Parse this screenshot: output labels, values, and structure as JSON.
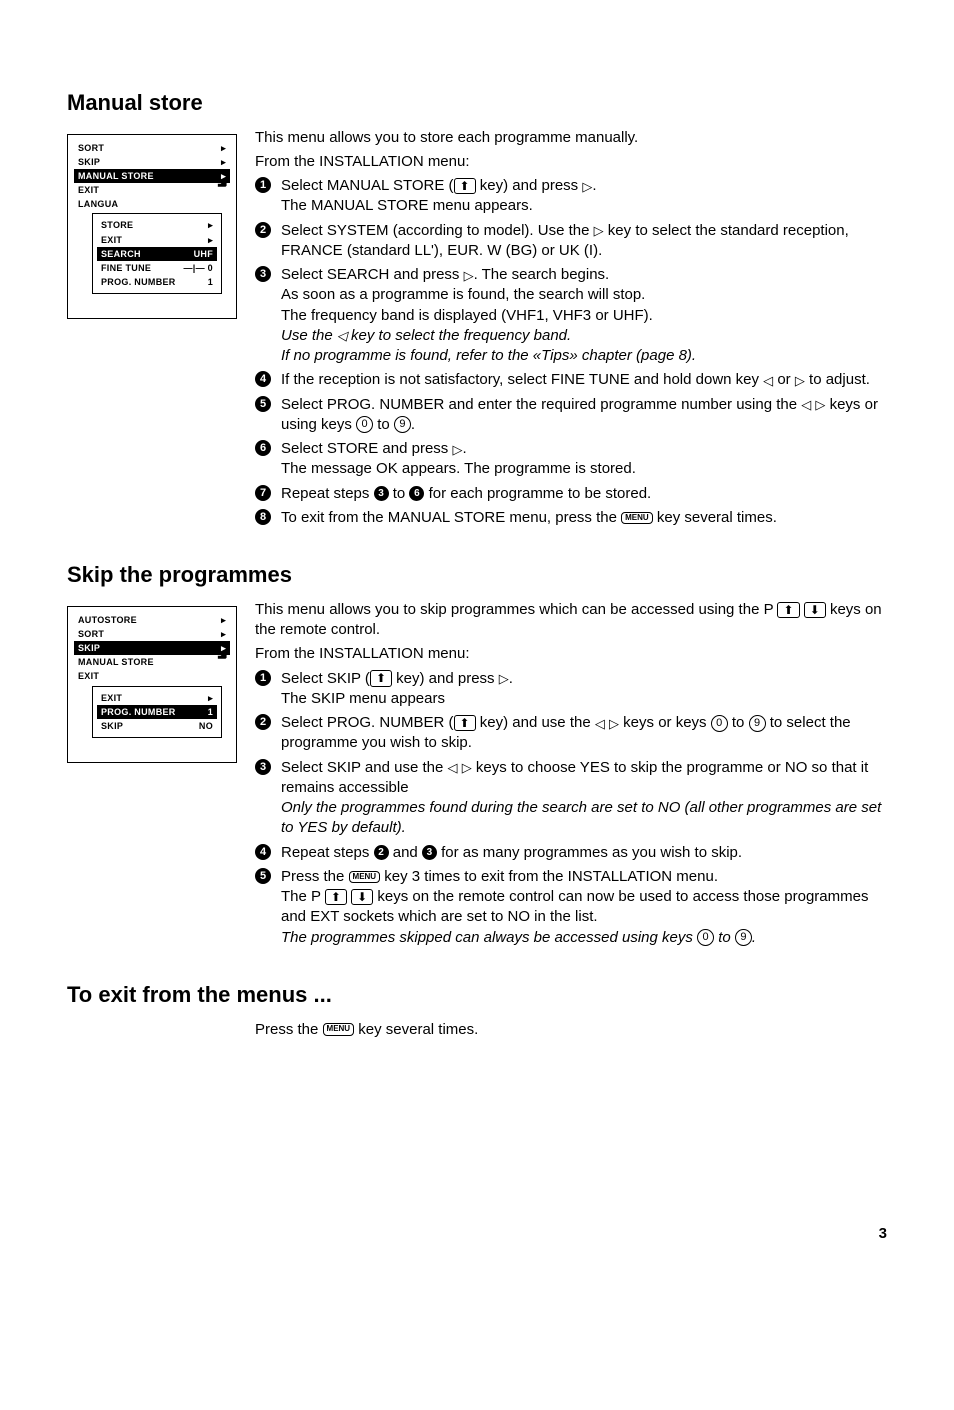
{
  "page_number": "3",
  "sections": {
    "manual_store": {
      "title": "Manual store",
      "intro1": "This menu allows you to store each programme manually.",
      "intro2": "From the INSTALLATION menu:",
      "menu1": {
        "items": [
          "SORT",
          "SKIP",
          "MANUAL STORE",
          "EXIT",
          "LANGUA"
        ],
        "sel_index": 2,
        "inner_items": [
          {
            "label": "STORE",
            "val": "▸"
          },
          {
            "label": "EXIT",
            "val": "▸"
          },
          {
            "label": "SEARCH",
            "val": "UHF",
            "sel": true
          },
          {
            "label": "FINE TUNE",
            "val": "—|— 0"
          },
          {
            "label": "PROG. NUMBER",
            "val": "1"
          }
        ]
      },
      "steps": [
        "Select MANUAL STORE (⬆ key) and press ▷.\nThe MANUAL STORE menu appears.",
        "Select SYSTEM (according to model). Use the ▷ key to select the standard reception, FRANCE (standard LL'), EUR. W (BG) or UK (I).",
        "Select SEARCH and press ▷. The search begins.\nAs soon as a programme is found, the search will stop.\nThe frequency band is displayed (VHF1, VHF3 or UHF).\n<i>Use the ◁ key to select the frequency band.</i>\n<i>If no programme is found, refer to the «Tips» chapter (page 8).</i>",
        "If the reception is not satisfactory, select FINE TUNE and hold down key ◁ or ▷ to adjust.",
        "Select PROG. NUMBER and enter the required programme number using the ◁ ▷ keys or using keys ⓪ to ⑨.",
        "Select STORE and press ▷.\nThe message OK appears. The programme is stored.",
        "Repeat steps ③ to ⑥ for each programme to be stored.",
        "To exit from the MANUAL STORE menu, press the [MENU] key several times."
      ]
    },
    "skip": {
      "title": "Skip the programmes",
      "intro1": "This menu allows you to skip programmes which can be accessed using the P ⬆ ⬇ keys on the remote control.",
      "intro2": "From the INSTALLATION menu:",
      "menu1": {
        "items": [
          "AUTOSTORE",
          "SORT",
          "SKIP",
          "MANUAL STORE",
          "EXIT"
        ],
        "sel_index": 2,
        "inner_items": [
          {
            "label": "EXIT",
            "val": "▸"
          },
          {
            "label": "PROG. NUMBER",
            "val": "1",
            "sel": true
          },
          {
            "label": "SKIP",
            "val": "NO"
          }
        ]
      },
      "steps": [
        "Select SKIP (⬆ key) and press ▷.\nThe SKIP menu appears",
        "Select PROG. NUMBER (⬆ key) and use the ◁ ▷ keys or keys ⓪ to ⑨ to select the programme you wish to skip.",
        "Select SKIP and use the ◁ ▷ keys to choose YES to skip the programme or NO so that it remains accessible\n<i>Only the programmes found during the search are set to NO (all other programmes are set to YES by default).</i>",
        "Repeat steps ② and ③ for as many programmes as you wish to skip.",
        "Press the [MENU] key 3 times to exit from the INSTALLATION menu.\nThe P ⬆ ⬇ keys on the remote control can now be used to access those programmes and EXT sockets which are set to NO in the list.\n<i>The programmes skipped can always be accessed using keys ⓪ to ⑨.</i>"
      ]
    },
    "exit": {
      "title": "To exit from the menus ...",
      "body": "Press the [MENU] key several times."
    }
  }
}
